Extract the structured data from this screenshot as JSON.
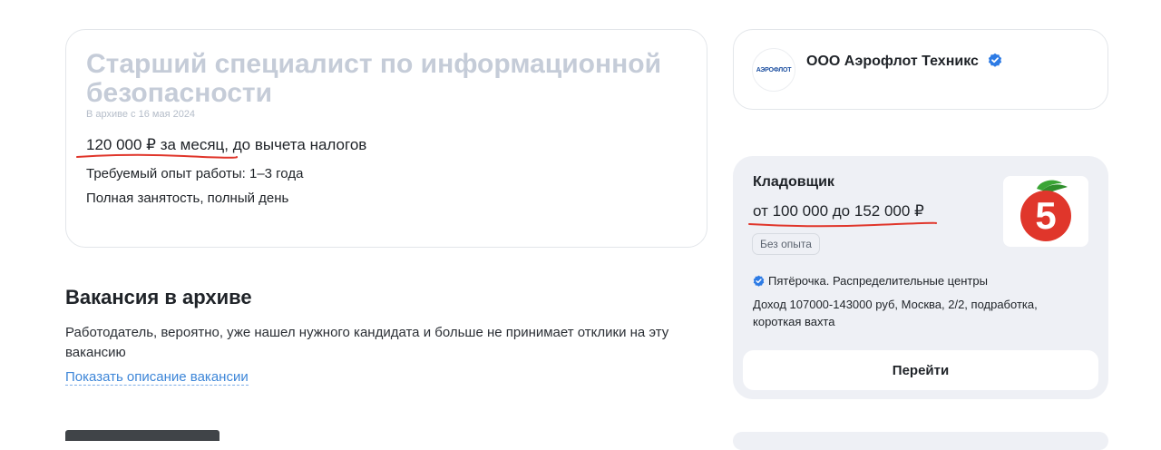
{
  "vacancy": {
    "title": "Старший специалист по информационной безопасности",
    "archived_note": "В архиве с 16 мая 2024",
    "salary": "120 000 ₽ за месяц, до вычета налогов",
    "experience": "Требуемый опыт работы: 1–3 года",
    "employment": "Полная занятость, полный день"
  },
  "archive": {
    "heading": "Вакансия в архиве",
    "text": "Работодатель, вероятно, уже нашел нужного кандидата и больше не принимает отклики на эту вакансию",
    "link": "Показать описание вакансии"
  },
  "employer": {
    "name": "ООО Аэрофлот Техникс",
    "logo_text": "АЭРОФЛОТ",
    "verified_icon": "verified-check-icon"
  },
  "recommended": {
    "title": "Кладовщик",
    "salary": "от 100 000  до 152 000 ₽",
    "badge": "Без опыта",
    "company": "Пятёрочка. Распределительные центры",
    "description": "Доход 107000-143000 руб, Москва, 2/2, подработка, короткая вахта",
    "button": "Перейти",
    "logo_text": "5"
  },
  "colors": {
    "accent_link": "#3d86d8",
    "underline_red": "#e0362b",
    "verified_blue": "#2d7be5",
    "card_bg_muted": "#eef0f5"
  }
}
